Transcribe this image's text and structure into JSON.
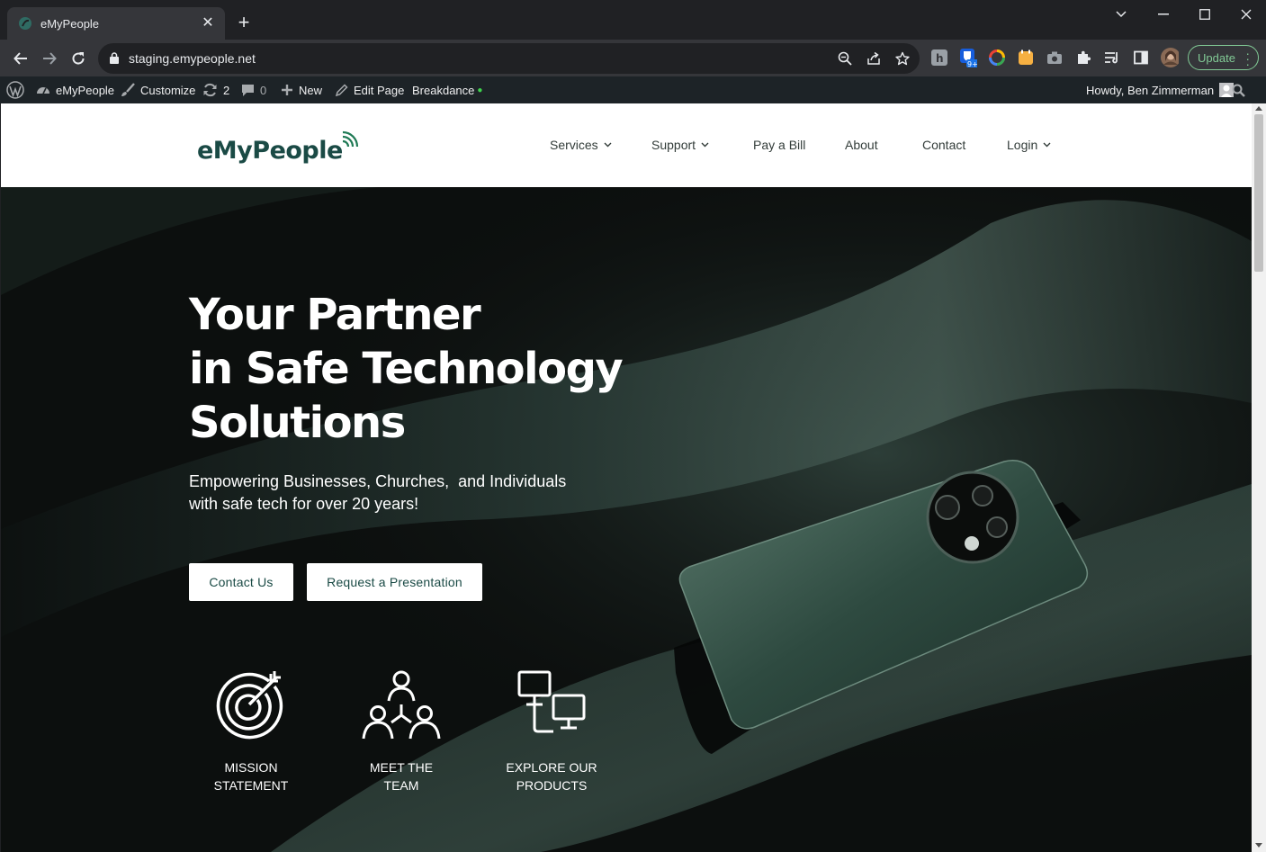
{
  "browser": {
    "tab_title": "eMyPeople",
    "url": "staging.emypeople.net",
    "update_label": "Update",
    "extension_badge": "9+"
  },
  "adminbar": {
    "site_name": "eMyPeople",
    "customize": "Customize",
    "updates_count": "2",
    "comments_count": "0",
    "new": "New",
    "edit_page": "Edit Page",
    "breakdance": "Breakdance",
    "howdy": "Howdy, Ben Zimmerman"
  },
  "site": {
    "logo_text": "eMyPeople",
    "nav": [
      "Services",
      "Support",
      "Pay a Bill",
      "About",
      "Contact",
      "Login"
    ]
  },
  "hero": {
    "title_lines": [
      "Your Partner",
      "in Safe Technology",
      "Solutions"
    ],
    "subtitle_lines": [
      "Empowering Businesses, Churches,  and Individuals",
      "with safe tech for over 20 years!"
    ],
    "buttons": [
      "Contact Us",
      "Request a Presentation"
    ],
    "features": [
      {
        "line1": "MISSION",
        "line2": "STATEMENT",
        "icon": "target-icon"
      },
      {
        "line1": "MEET THE",
        "line2": "TEAM",
        "icon": "team-icon"
      },
      {
        "line1": "EXPLORE OUR",
        "line2": "PRODUCTS",
        "icon": "monitors-icon"
      }
    ]
  },
  "colors": {
    "brand": "#1a4a45",
    "accent_green": "#81c995",
    "adminbar": "#1d2327",
    "hero_bg": "#0c0f0e"
  }
}
